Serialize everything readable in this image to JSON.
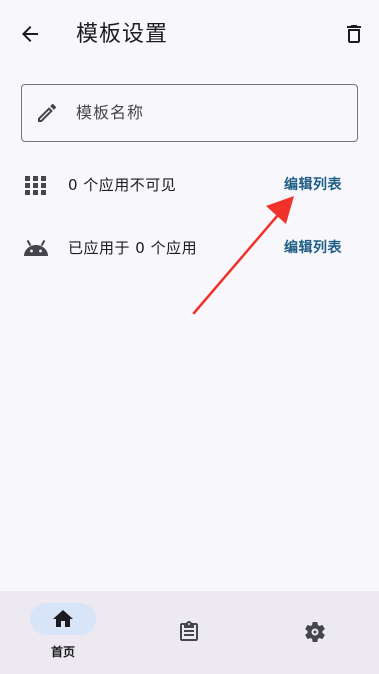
{
  "header": {
    "title": "模板设置",
    "back_icon": "arrow-back-icon",
    "delete_icon": "trash-icon"
  },
  "name_field": {
    "placeholder": "模板名称",
    "icon": "pencil-icon"
  },
  "rows": [
    {
      "icon": "apps-grid-icon",
      "text": "0 个应用不可见",
      "action": "编辑列表"
    },
    {
      "icon": "android-icon",
      "text": "已应用于 0 个应用",
      "action": "编辑列表"
    }
  ],
  "annotation": {
    "color": "#f0322a"
  },
  "nav": {
    "items": [
      {
        "icon": "home-icon",
        "label": "首页",
        "selected": true
      },
      {
        "icon": "clipboard-icon",
        "label": "",
        "selected": false
      },
      {
        "icon": "gear-icon",
        "label": "",
        "selected": false
      }
    ]
  },
  "colors": {
    "link": "#1f5f85",
    "nav_indicator": "#d8e4f8",
    "background": "#f8f7fc"
  }
}
